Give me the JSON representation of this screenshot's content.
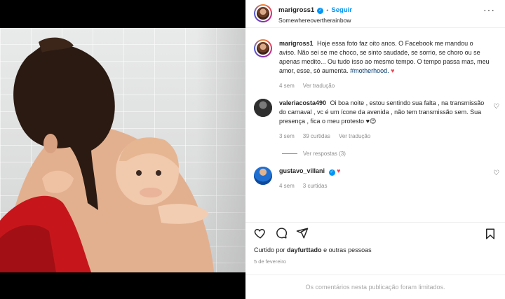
{
  "header": {
    "username": "marigross1",
    "follow_label": "Seguir",
    "separator": "•",
    "subtitle": "Somewhereovertherainbow",
    "more_label": "···"
  },
  "caption": {
    "username": "marigross1",
    "text": "Hoje essa foto faz oito anos. O Facebook me mandou o aviso. Não sei se me choco, se sinto saudade, se sorrio, se choro ou se apenas medito... Ou tudo isso ao mesmo tempo. O tempo passa mas, meu amor, esse, só aumenta.",
    "hashtag": "#motherhood.",
    "emoji": "♥",
    "time": "4 sem",
    "translate": "Ver tradução"
  },
  "comments": [
    {
      "username": "valeriacosta490",
      "text": "Oi boa noite , estou sentindo sua falta , na transmissão do carnaval , vc é um ícone da avenida , não tem transmissão sem. Sua presença , fica o meu protesto",
      "emoji": "♥😍",
      "time": "3 sem",
      "likes": "39 curtidas",
      "translate": "Ver tradução",
      "replies": "Ver respostas (3)"
    },
    {
      "username": "gustavo_villani",
      "emoji": "♥",
      "time": "4 sem",
      "likes": "3 curtidas"
    }
  ],
  "likes": {
    "prefix": "Curtido por",
    "user": "dayfurttado",
    "suffix": "e outras pessoas"
  },
  "date": "5 de fevereiro",
  "footer_notice": "Os comentários nesta publicação foram limitados.",
  "icons": {
    "like": "heart-outline-icon",
    "comment": "speech-bubble-icon",
    "share": "paper-plane-icon",
    "save": "bookmark-icon"
  },
  "colors": {
    "accent": "#0095f6",
    "heart": "#ed4956",
    "muted": "#8e8e8e",
    "hashtag": "#00376b"
  }
}
